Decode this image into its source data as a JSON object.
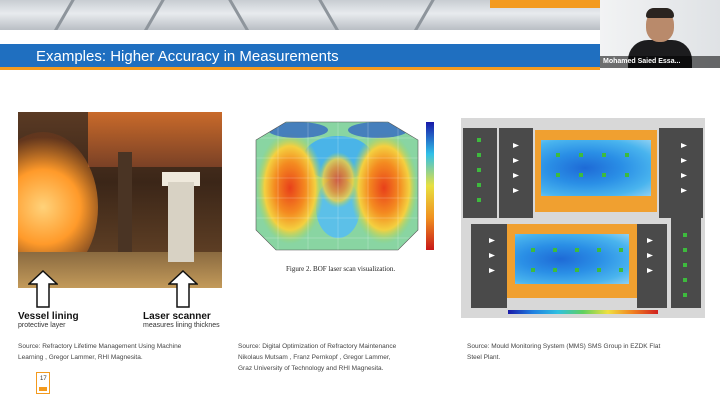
{
  "slide": {
    "title": "Examples: Higher Accuracy in Measurements",
    "page_number": "17"
  },
  "webcam": {
    "participant_name": "Mohamed Saied Essa..."
  },
  "left_figure": {
    "label_1_title": "Vessel lining",
    "label_1_sub": "protective layer",
    "label_2_title": "Laser scanner",
    "label_2_sub": "measures lining thicknes",
    "source_lines": [
      "Source: Refractory Lifetime Management Using Machine",
      "Learning , Gregor Lammer, RHI Magnesita."
    ]
  },
  "middle_figure": {
    "caption": "Figure 2. BOF laser scan visualization.",
    "source_lines": [
      "Source: Digital Optimization of Refractory Maintenance",
      "Nikolaus Mutsam , Franz Pernkopf , Gregor Lammer,",
      "Graz University of Technology and RHI Magnesita."
    ]
  },
  "right_figure": {
    "source_lines": [
      "Source: Mould Monitoring System (MMS) SMS Group in EZDK Flat",
      "Steel Plant."
    ]
  },
  "colors": {
    "brand_blue": "#1f6fc0",
    "accent_orange": "#f39a1e"
  }
}
